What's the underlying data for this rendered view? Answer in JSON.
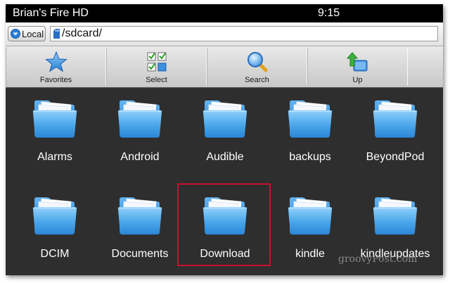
{
  "status_bar": {
    "device_name": "Brian's Fire HD",
    "time": "9:15"
  },
  "address_bar": {
    "location_label": "Local",
    "path": "/sdcard/"
  },
  "toolbar": {
    "buttons": [
      {
        "label": "Favorites",
        "icon": "star-icon"
      },
      {
        "label": "Select",
        "icon": "select-grid-icon"
      },
      {
        "label": "Search",
        "icon": "magnifier-icon"
      },
      {
        "label": "Up",
        "icon": "up-folder-icon"
      }
    ]
  },
  "files": [
    {
      "name": "Alarms"
    },
    {
      "name": "Android"
    },
    {
      "name": "Audible"
    },
    {
      "name": "backups"
    },
    {
      "name": "BeyondPod"
    },
    {
      "name": "DCIM"
    },
    {
      "name": "Documents"
    },
    {
      "name": "Download",
      "selected": true
    },
    {
      "name": "kindle"
    },
    {
      "name": "kindleupdates"
    }
  ],
  "watermark": "groovyPost.com",
  "colors": {
    "selection_outline": "#c8102e",
    "folder_blue": "#3f9fe6",
    "background": "#2e2e2e"
  }
}
